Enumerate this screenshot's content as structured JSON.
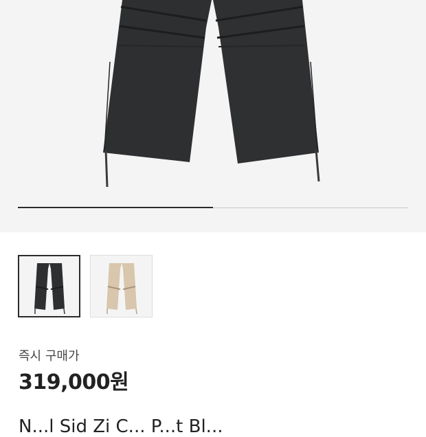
{
  "gallery": {
    "progress_fraction": 0.5,
    "thumbnails": [
      {
        "name": "black",
        "color": "#2e2f31",
        "selected": true
      },
      {
        "name": "beige",
        "color": "#d8c6ad",
        "selected": false
      }
    ]
  },
  "product": {
    "price_label": "즉시 구매가",
    "price": "319,000원",
    "title_partial": "N...l Sid  Zi  C...  P...t  Bl..."
  },
  "colors": {
    "dark": "#222222",
    "hero_bg": "#f4f4f4",
    "pants_black": "#2e2f31",
    "pants_beige": "#d8c6ad"
  }
}
